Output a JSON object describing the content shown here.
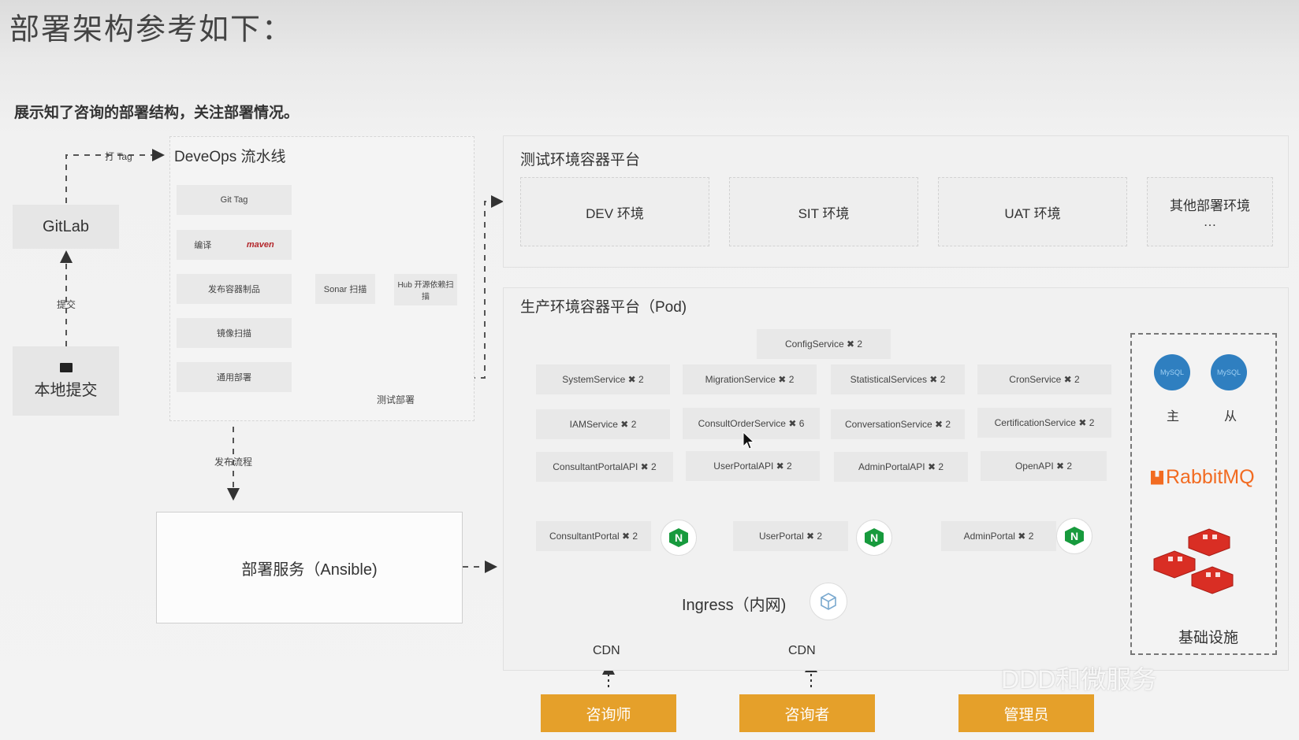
{
  "page": {
    "title": "部署架构参考如下：",
    "subtitle": "展示知了咨询的部署结构，关注部署情况。"
  },
  "left": {
    "gitlab": "GitLab",
    "local_commit": "本地提交",
    "commit_label": "提交",
    "tag_label": "打 Tag"
  },
  "devops": {
    "title": "DeveOps 流水线",
    "steps": {
      "git_tag": "Git Tag",
      "compile": "编译",
      "maven": "maven",
      "publish": "发布容器制品",
      "sonar": "Sonar 扫描",
      "hub": "Hub 开源依赖扫描",
      "image_scan": "镜像扫描",
      "general_deploy": "通用部署"
    },
    "test_deploy_label": "测试部署",
    "release_flow_label": "发布流程"
  },
  "deploy_service": "部署服务（Ansible)",
  "test_platform": {
    "title": "测试环境容器平台",
    "envs": [
      "DEV 环境",
      "SIT 环境",
      "UAT 环境",
      "其他部署环境"
    ],
    "more": "…"
  },
  "prod_platform": {
    "title": "生产环境容器平台（Pod)",
    "config_service": "ConfigService ✖ 2",
    "services": [
      "SystemService ✖ 2",
      "MigrationService ✖ 2",
      "StatisticalServices ✖ 2",
      "CronService ✖ 2",
      "IAMService ✖ 2",
      "ConsultOrderService ✖ 6",
      "ConversationService ✖ 2",
      "CertificationService ✖ 2",
      "ConsultantPortalAPI ✖ 2",
      "UserPortalAPI ✖ 2",
      "AdminPortalAPI ✖ 2",
      "OpenAPI ✖ 2"
    ],
    "portals": [
      "ConsultantPortal ✖ 2",
      "UserPortal ✖ 2",
      "AdminPortal ✖ 2"
    ],
    "ingress": "Ingress（内网)",
    "cdn": [
      "CDN",
      "CDN"
    ]
  },
  "infra": {
    "master": "主",
    "slave": "从",
    "mysql": "MySQL",
    "rabbitmq": "RabbitMQ",
    "label": "基础设施"
  },
  "roles": [
    "咨询师",
    "咨询者",
    "管理员"
  ],
  "watermark": "DDD和微服务",
  "colors": {
    "role_orange": "#e5a02a",
    "nginx_green": "#179a3d",
    "mysql_blue": "#2f7fc0",
    "rabbit_orange": "#f26b21",
    "redis_red": "#d92e24"
  }
}
